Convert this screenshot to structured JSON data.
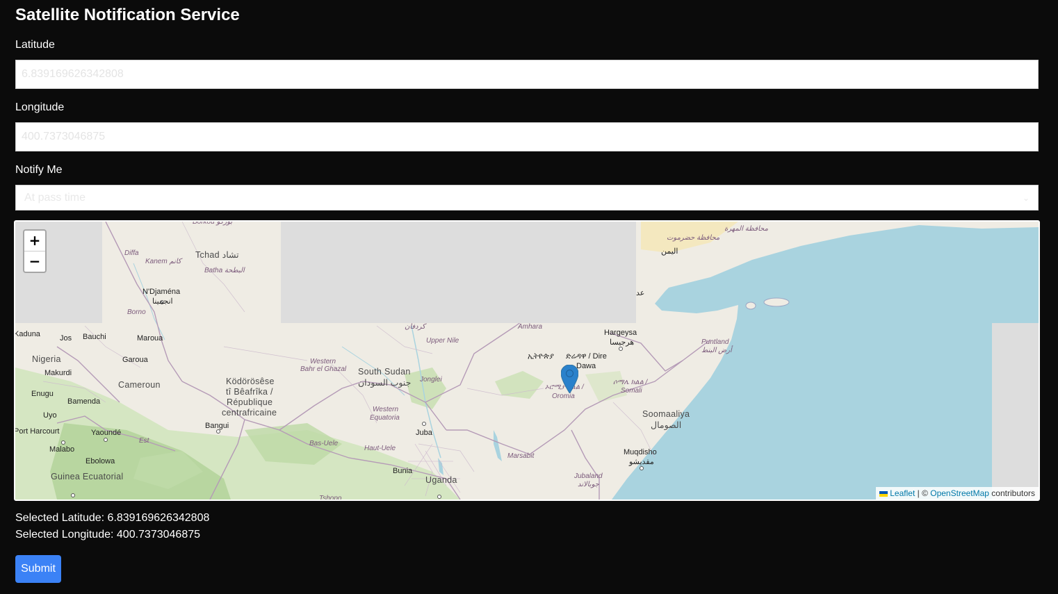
{
  "page": {
    "title": "Satellite Notification Service"
  },
  "form": {
    "latitude": {
      "label": "Latitude",
      "placeholder": "6.839169626342808",
      "value": ""
    },
    "longitude": {
      "label": "Longitude",
      "placeholder": "400.7373046875",
      "value": ""
    },
    "notify": {
      "label": "Notify Me",
      "selected": "At pass time"
    }
  },
  "map": {
    "zoom_in": "+",
    "zoom_out": "−",
    "attribution": {
      "leaflet": "Leaflet",
      "separator": " | © ",
      "osm": "OpenStreetMap",
      "suffix": " contributors"
    },
    "labels": {
      "chad": "Tchad تشاد",
      "kanem": "Kanem كانم",
      "batha": "Batha البطحة",
      "diffa": "Diffa",
      "borkou": "Borkou بوركو",
      "ndjamena": "N'Djaména",
      "ndjamena_ar": "انجمينا",
      "borno": "Borno",
      "kaduna": "Kaduna",
      "jos": "Jos",
      "bauchi": "Bauchi",
      "maroua": "Maroua",
      "nigeria": "Nigeria",
      "garoua": "Garoua",
      "makurdi": "Makurdi",
      "cameroun": "Cameroun",
      "enugu": "Enugu",
      "bamenda": "Bamenda",
      "uyo": "Uyo",
      "port_harcourt": "Port Harcourt",
      "yaounde": "Yaoundé",
      "malabo": "Malabo",
      "ebolowa": "Ebolowa",
      "guinea_eq": "Guinea Ecuatorial",
      "est": "Est",
      "car_1": "Ködörösêse",
      "car_2": "tî Bêafrîka /",
      "car_3": "République",
      "car_4": "centrafricaine",
      "bangui": "Bangui",
      "western_bahr": "Western",
      "western_bahr_2": "Bahr el Ghazal",
      "south_sudan": "South Sudan",
      "south_sudan_ar": "جنوب السودان",
      "jonglei": "Jonglei",
      "upper_nile": "Upper Nile",
      "kordofan": "كردفان",
      "western_eq": "Western",
      "western_eq_2": "Equatoria",
      "juba": "Juba",
      "bas_uele": "Bas-Uele",
      "haut_uele": "Haut-Uele",
      "bunia": "Bunia",
      "uganda": "Uganda",
      "tshopo": "Tshopo",
      "amhara": "Amhara",
      "ethiopia": "ኢትዮጵያ",
      "dire_dawa_1": "ድሬዳዋ / Dire",
      "dire_dawa_2": "Dawa",
      "oromia_1": "ኦሮሚያ ክልል /",
      "oromia_2": "Oromia",
      "somali_1": "ሶማሌ ክልል /",
      "somali_2": "Somali",
      "hargeysa": "Hargeysa",
      "hargeysa_ar": "هرجيسا",
      "puntland": "Puntland",
      "puntland_ar": "أرض البنط",
      "somalia": "Soomaaliya",
      "somalia_ar": "الصومال",
      "muqdisho": "Muqdisho",
      "muqdisho_ar": "مقديشو",
      "marsabit": "Marsabit",
      "jubaland": "Jubaland",
      "jubaland_ar": "جوبالاند",
      "yemen": "اليمن",
      "hadramaut": "محافظة حضرموت",
      "mahra": "محافظة المهرة",
      "aden": "عد"
    }
  },
  "selection": {
    "latitude_text": "Selected Latitude: 6.839169626342808",
    "longitude_text": "Selected Longitude: 400.7373046875"
  },
  "submit_label": "Submit",
  "colors": {
    "background": "#0b0b0b",
    "submit": "#3b82f6",
    "water": "#a9d3df",
    "land": "#efece4",
    "forest": "#c7dfb1",
    "missing_tile": "#dddddd",
    "marker": "#2a81cb"
  }
}
